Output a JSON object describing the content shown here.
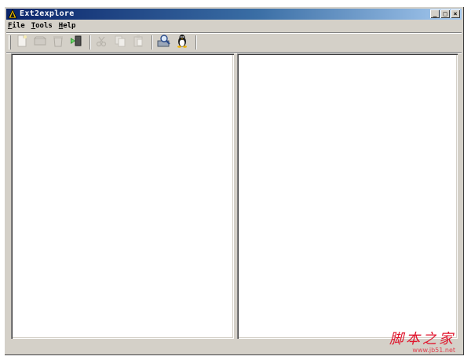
{
  "window": {
    "title": "Ext2explore",
    "controls": {
      "minimize": "_",
      "maximize": "□",
      "close": "×"
    }
  },
  "menubar": {
    "items": [
      {
        "accel": "F",
        "rest": "ile"
      },
      {
        "accel": "T",
        "rest": "ools"
      },
      {
        "accel": "H",
        "rest": "elp"
      }
    ]
  },
  "toolbar": {
    "buttons": [
      {
        "icon": "new-document-icon",
        "enabled": false
      },
      {
        "icon": "open-disk-icon",
        "enabled": false
      },
      {
        "icon": "delete-bin-icon",
        "enabled": false
      },
      {
        "icon": "save-export-icon",
        "enabled": true
      },
      {
        "icon": "cut-icon",
        "enabled": false
      },
      {
        "icon": "copy-icon",
        "enabled": false
      },
      {
        "icon": "paste-icon",
        "enabled": false
      },
      {
        "icon": "search-drive-icon",
        "enabled": true
      },
      {
        "icon": "linux-tux-icon",
        "enabled": true
      }
    ]
  },
  "watermark": {
    "main": "脚本之家",
    "sub": "www.jb51.net"
  },
  "colors": {
    "titlebar_start": "#0a246a",
    "titlebar_end": "#a6caf0",
    "face": "#d4d0c8",
    "pane": "#ffffff",
    "watermark": "#e0142c"
  }
}
